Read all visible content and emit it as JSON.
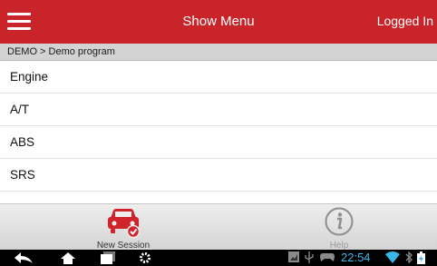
{
  "header": {
    "title": "Show Menu",
    "status": "Logged In"
  },
  "breadcrumb": "DEMO > Demo program",
  "menu_items": [
    {
      "label": "Engine"
    },
    {
      "label": "A/T"
    },
    {
      "label": "ABS"
    },
    {
      "label": "SRS"
    }
  ],
  "bottom_bar": {
    "new_session_label": "New Session",
    "help_label": "Help"
  },
  "system_bar": {
    "time": "22:54"
  },
  "colors": {
    "accent": "#c8242a",
    "clock": "#39b6ea"
  },
  "icons": [
    "hamburger-menu-icon",
    "car-check-icon",
    "info-icon",
    "back-icon",
    "home-icon",
    "recent-apps-icon",
    "settings-icon",
    "screenshot-icon",
    "usb-icon",
    "gamepad-icon",
    "wifi-icon",
    "battery-icon"
  ]
}
